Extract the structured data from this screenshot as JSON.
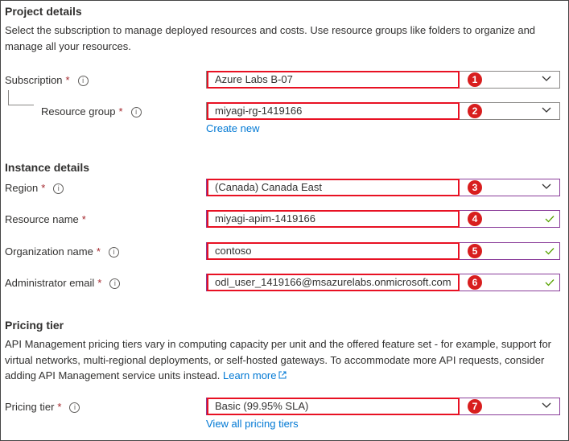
{
  "project": {
    "heading": "Project details",
    "description": "Select the subscription to manage deployed resources and costs. Use resource groups like folders to organize and manage all your resources.",
    "subscription": {
      "label": "Subscription",
      "value": "Azure Labs B-07",
      "badge": "1"
    },
    "resource_group": {
      "label": "Resource group",
      "value": "miyagi-rg-1419166",
      "badge": "2",
      "create_new": "Create new"
    }
  },
  "instance": {
    "heading": "Instance details",
    "region": {
      "label": "Region",
      "value": "(Canada) Canada East",
      "badge": "3"
    },
    "resource_name": {
      "label": "Resource name",
      "value": "miyagi-apim-1419166",
      "badge": "4"
    },
    "organization_name": {
      "label": "Organization name",
      "value": "contoso",
      "badge": "5"
    },
    "admin_email": {
      "label": "Administrator email",
      "value": "odl_user_1419166@msazurelabs.onmicrosoft.com",
      "badge": "6"
    }
  },
  "pricing": {
    "heading": "Pricing tier",
    "description": "API Management pricing tiers vary in computing capacity per unit and the offered feature set - for example, support for virtual networks, multi-regional deployments, or self-hosted gateways. To accommodate more API requests, consider adding API Management service units instead.",
    "learn_more": "Learn more",
    "tier": {
      "label": "Pricing tier",
      "value": "Basic (99.95% SLA)",
      "badge": "7"
    },
    "view_all": "View all pricing tiers"
  },
  "common": {
    "required_mark": "*",
    "info_glyph": "i"
  },
  "colors": {
    "annotation_red": "#e81123",
    "badge_red": "#d81e1e",
    "link_blue": "#0078d4",
    "valid_green": "#57a300",
    "valid_border": "#8a3d9a"
  }
}
